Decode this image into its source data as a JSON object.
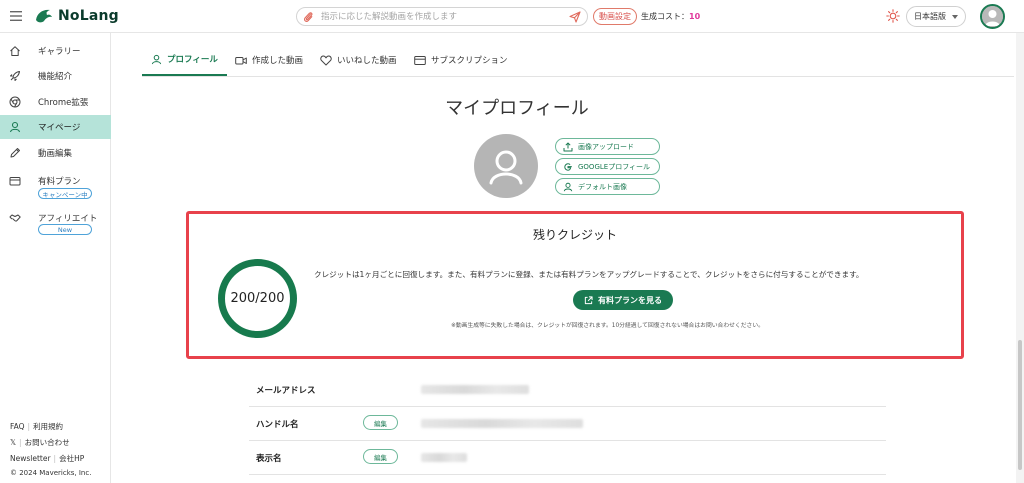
{
  "header": {
    "logo_text": "NoLang",
    "search_placeholder": "指示に応じた解説動画を作成します",
    "video_settings_label": "動画設定",
    "cost_label": "生成コスト：",
    "cost_value": "10",
    "language": "日本語版"
  },
  "sidebar": {
    "items": [
      {
        "label": "ギャラリー",
        "icon": "home-icon"
      },
      {
        "label": "機能紹介",
        "icon": "rocket-icon"
      },
      {
        "label": "Chrome拡張",
        "icon": "chrome-icon"
      },
      {
        "label": "マイページ",
        "icon": "user-icon"
      },
      {
        "label": "動画編集",
        "icon": "pencil-icon"
      },
      {
        "label": "有料プラン",
        "icon": "card-icon",
        "badge": "キャンペーン中"
      },
      {
        "label": "アフィリエイト",
        "icon": "handshake-icon",
        "badge": "New"
      }
    ],
    "footer": {
      "faq": "FAQ",
      "terms": "利用規約",
      "x": "𝕏",
      "contact": "お問い合わせ",
      "newsletter": "Newsletter",
      "company": "会社HP",
      "copyright": "© 2024 Mavericks, Inc."
    }
  },
  "tabs": [
    {
      "label": "プロフィール",
      "active": true
    },
    {
      "label": "作成した動画",
      "active": false
    },
    {
      "label": "いいねした動画",
      "active": false
    },
    {
      "label": "サブスクリプション",
      "active": false
    }
  ],
  "profile": {
    "title": "マイプロフィール",
    "upload_btn": "画像アップロード",
    "google_btn": "GOOGLEプロフィール",
    "default_btn": "デフォルト画像"
  },
  "credits": {
    "title": "残りクレジット",
    "display": "200/200",
    "remaining": 200,
    "total": 200,
    "description": "クレジットは1ヶ月ごとに回復します。また、有料プランに登録、または有料プランをアップグレードすることで、クレジットをさらに付与することができます。",
    "plan_button": "有料プランを見る",
    "note": "※動画生成等に失敗した場合は、クレジットが回復されます。10分経過して回復されない場合はお問い合わせください。"
  },
  "info": {
    "email_label": "メールアドレス",
    "handle_label": "ハンドル名",
    "display_name_label": "表示名",
    "edit_label": "編集"
  },
  "colors": {
    "brand": "#1a7a52",
    "active_bg": "#b5e3d9",
    "highlight": "#e8414b",
    "cost": "#e0389b"
  }
}
